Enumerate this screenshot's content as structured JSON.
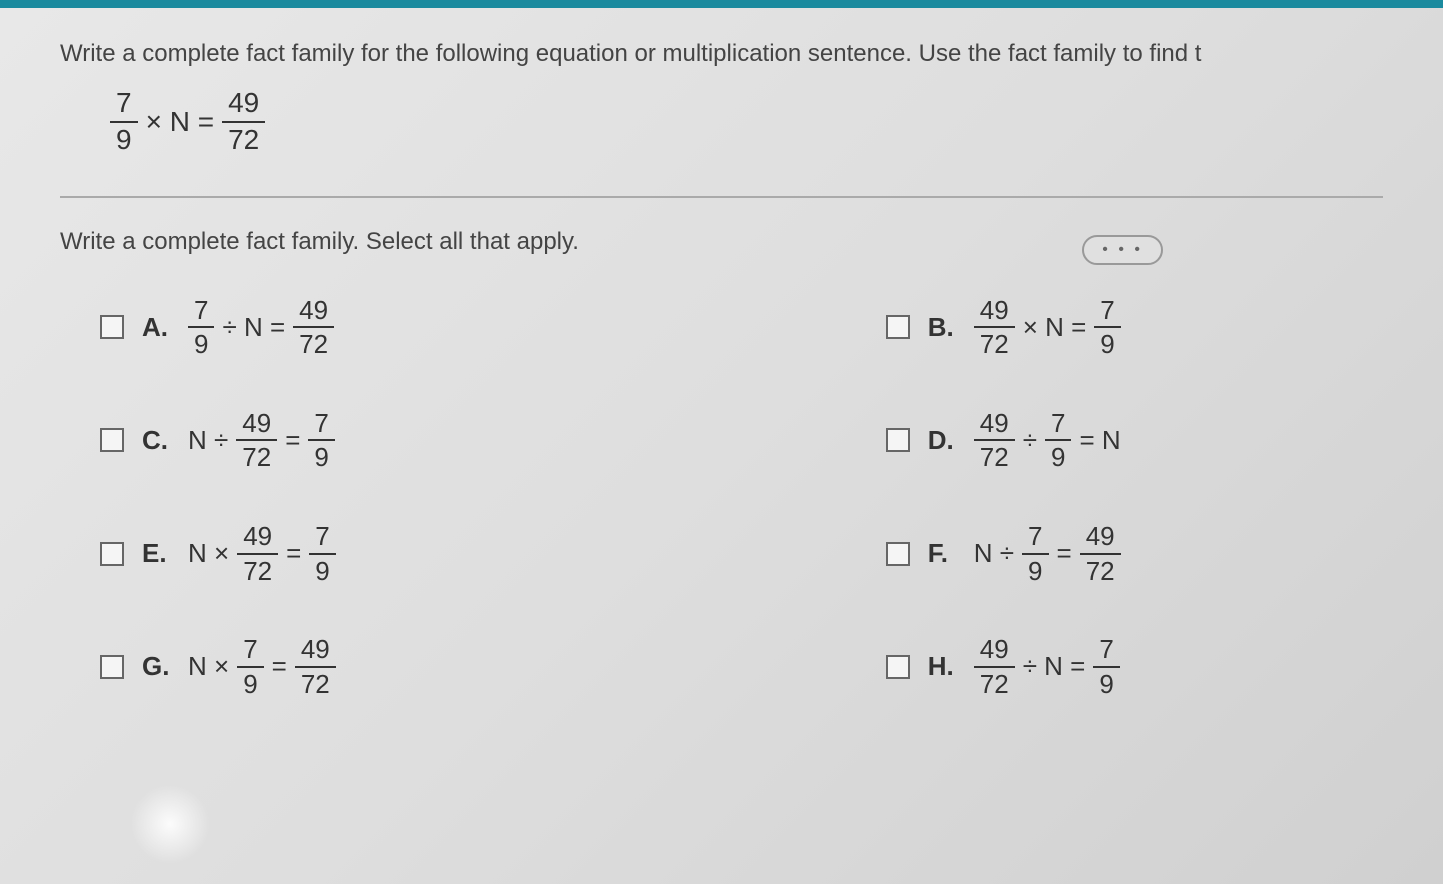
{
  "instruction": "Write a complete fact family for the following equation or multiplication sentence. Use the fact family to find t",
  "main_equation": {
    "frac1_num": "7",
    "frac1_den": "9",
    "op": "× N =",
    "frac2_num": "49",
    "frac2_den": "72"
  },
  "dots": "• • •",
  "sub_instruction": "Write a complete fact family. Select all that apply.",
  "options": {
    "A": {
      "letter": "A.",
      "f1n": "7",
      "f1d": "9",
      "mid": "÷ N =",
      "f2n": "49",
      "f2d": "72"
    },
    "B": {
      "letter": "B.",
      "f1n": "49",
      "f1d": "72",
      "mid": "× N =",
      "f2n": "7",
      "f2d": "9"
    },
    "C": {
      "letter": "C.",
      "pre": "N ÷",
      "f1n": "49",
      "f1d": "72",
      "mid": "=",
      "f2n": "7",
      "f2d": "9"
    },
    "D": {
      "letter": "D.",
      "f1n": "49",
      "f1d": "72",
      "mid": "÷",
      "f2n": "7",
      "f2d": "9",
      "post": "= N"
    },
    "E": {
      "letter": "E.",
      "pre": "N ×",
      "f1n": "49",
      "f1d": "72",
      "mid": "=",
      "f2n": "7",
      "f2d": "9"
    },
    "F": {
      "letter": "F.",
      "pre": "N ÷",
      "f1n": "7",
      "f1d": "9",
      "mid": "=",
      "f2n": "49",
      "f2d": "72"
    },
    "G": {
      "letter": "G.",
      "pre": "N ×",
      "f1n": "7",
      "f1d": "9",
      "mid": "=",
      "f2n": "49",
      "f2d": "72"
    },
    "H": {
      "letter": "H.",
      "f1n": "49",
      "f1d": "72",
      "mid": "÷ N =",
      "f2n": "7",
      "f2d": "9"
    }
  }
}
